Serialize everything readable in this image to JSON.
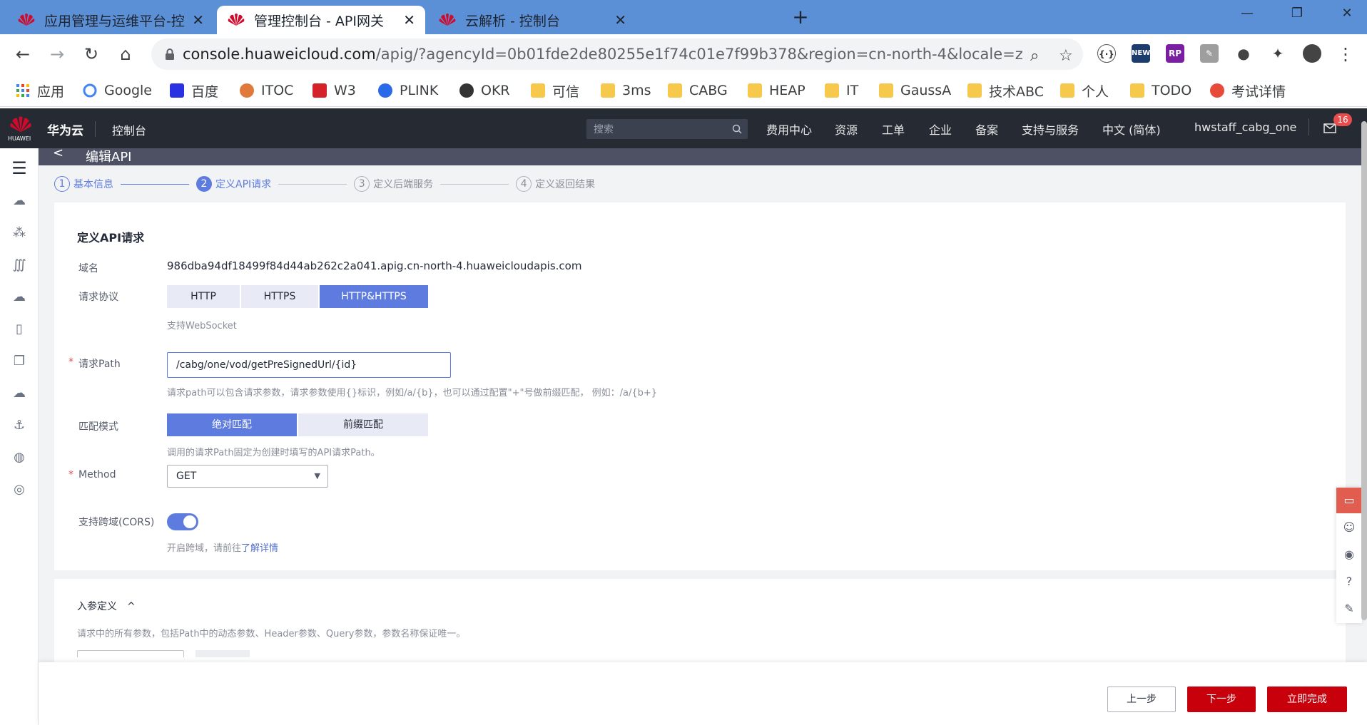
{
  "browser": {
    "tabs": [
      {
        "title": "应用管理与运维平台-控制台",
        "active": false
      },
      {
        "title": "管理控制台 - API网关",
        "active": true
      },
      {
        "title": "云解析 - 控制台",
        "active": false
      }
    ],
    "new_tab": "+",
    "window_controls": {
      "minimize": "—",
      "restore": "❐",
      "close": "✕"
    },
    "nav": {
      "back": "←",
      "forward": "→",
      "reload": "↻",
      "home": "⌂"
    },
    "url_host": "console.huaweicloud.com",
    "url_rest": "/apig/?agencyId=0b01fde2de80255e1f74c01e7f99b378&region=cn-north-4&locale=z...",
    "omnibox_icons": {
      "zoom": "⌕",
      "star": "☆"
    },
    "extensions": [
      {
        "name": "ext-braces",
        "glyph": "{·}",
        "color": "#ffffff"
      },
      {
        "name": "ext-new",
        "glyph": "NEW",
        "color": "#1d3c6e"
      },
      {
        "name": "ext-rp",
        "glyph": "RP",
        "color": "#7a1fa2"
      },
      {
        "name": "ext-pdf",
        "glyph": "✎",
        "color": "#9e9e9e"
      },
      {
        "name": "ext-circle",
        "glyph": "●",
        "color": "#ffffff"
      },
      {
        "name": "ext-puzzle",
        "glyph": "✦",
        "color": "#ffffff"
      }
    ],
    "menu": "⋮",
    "bookmarks": [
      {
        "label": "应用",
        "icon": "apps-grid"
      },
      {
        "label": "Google",
        "icon": "google"
      },
      {
        "label": "百度",
        "icon": "baidu"
      },
      {
        "label": "ITOC",
        "icon": "itoc"
      },
      {
        "label": "W3",
        "icon": "w3"
      },
      {
        "label": "PLINK",
        "icon": "plink"
      },
      {
        "label": "OKR",
        "icon": "okr"
      },
      {
        "label": "可信",
        "icon": "folder"
      },
      {
        "label": "3ms",
        "icon": "folder"
      },
      {
        "label": "CABG",
        "icon": "folder"
      },
      {
        "label": "HEAP",
        "icon": "folder"
      },
      {
        "label": "IT",
        "icon": "folder"
      },
      {
        "label": "GaussA",
        "icon": "folder"
      },
      {
        "label": "技术ABC",
        "icon": "folder"
      },
      {
        "label": "个人",
        "icon": "folder"
      },
      {
        "label": "TODO",
        "icon": "folder"
      },
      {
        "label": "考试详情",
        "icon": "exam"
      }
    ]
  },
  "console_bar": {
    "logo_text": "HUAWEI",
    "brand": "华为云",
    "console": "控制台",
    "search_placeholder": "搜索",
    "nav": [
      "费用中心",
      "资源",
      "工单",
      "企业",
      "备案",
      "支持与服务",
      "中文 (简体)",
      "hwstaff_cabg_one"
    ],
    "message_badge": "16"
  },
  "page": {
    "title": "编辑API",
    "back": "<",
    "steps": [
      {
        "num": "1",
        "label": "基本信息",
        "state": "done"
      },
      {
        "num": "2",
        "label": "定义API请求",
        "state": "active"
      },
      {
        "num": "3",
        "label": "定义后端服务",
        "state": "todo"
      },
      {
        "num": "4",
        "label": "定义返回结果",
        "state": "todo"
      }
    ]
  },
  "form": {
    "section_title": "定义API请求",
    "domain_label": "域名",
    "domain_value": "986dba94df18499f84d44ab262c2a041.apig.cn-north-4.huaweicloudapis.com",
    "protocol_label": "请求协议",
    "protocol_options": [
      "HTTP",
      "HTTPS",
      "HTTP&HTTPS"
    ],
    "protocol_selected": "HTTP&HTTPS",
    "protocol_hint": "支持WebSocket",
    "path_required": "*",
    "path_label": "请求Path",
    "path_value": "/cabg/one/vod/getPreSignedUrl/{id}",
    "path_hint": "请求path可以包含请求参数，请求参数使用{}标识，例如/a/{b}，也可以通过配置\"+\"号做前缀匹配， 例如：/a/{b+}",
    "match_label": "匹配模式",
    "match_options": [
      "绝对匹配",
      "前缀匹配"
    ],
    "match_selected": "绝对匹配",
    "match_hint": "调用的请求Path固定为创建时填写的API请求Path。",
    "method_required": "*",
    "method_label": "Method",
    "method_value": "GET",
    "cors_label": "支持跨域(CORS)",
    "cors_enabled": true,
    "cors_hint": "开启跨域，请前往",
    "cors_link": "了解详情"
  },
  "params": {
    "title": "入参定义",
    "toggle": "^",
    "description": "请求中的所有参数，包括Path中的动态参数、Header参数、Query参数，参数名称保证唯一。"
  },
  "footer": {
    "prev": "上一步",
    "next": "下一步",
    "finish": "立即完成"
  },
  "colors": {
    "accent": "#5e7ce0",
    "primary_button": "#c7000b",
    "console_bar": "#262b33",
    "tabstrip": "#5b8fd6"
  }
}
